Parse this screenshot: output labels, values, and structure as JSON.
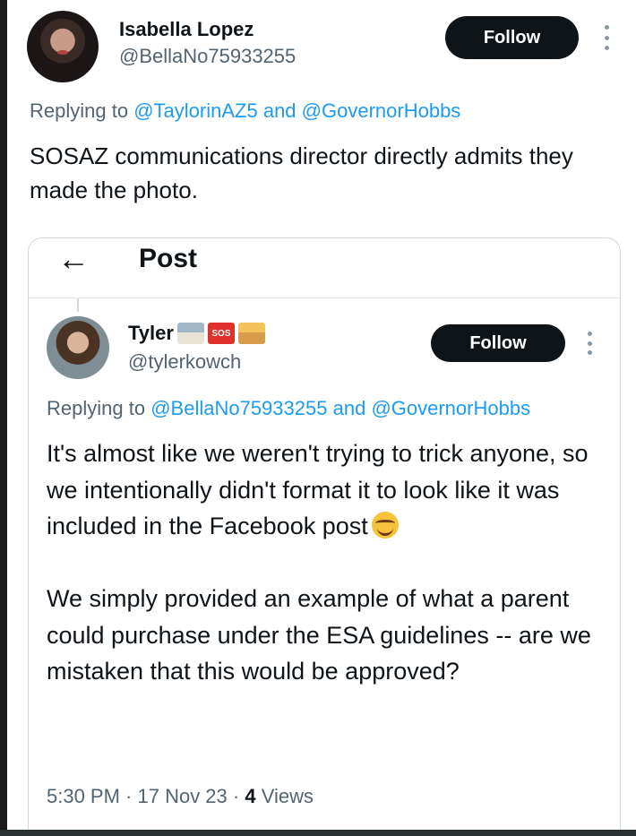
{
  "outer_tweet": {
    "author_name": "Isabella Lopez",
    "author_handle": "@BellaNo75933255",
    "follow_label": "Follow",
    "reply_prefix": "Replying to",
    "reply_mention_1": "@TaylorinAZ5",
    "reply_and": "and",
    "reply_mention_2": "@GovernorHobbs",
    "text": "SOSAZ communications director directly admits they made the photo."
  },
  "embedded_post": {
    "header_title": "Post",
    "back_icon": "arrow-left-icon",
    "author_name": "Tyler",
    "author_emojis": [
      "school-emoji",
      "sos-emoji",
      "desert-emoji"
    ],
    "sos_text": "SOS",
    "author_handle": "@tylerkowch",
    "follow_label": "Follow",
    "reply_prefix": "Replying to",
    "reply_mention_1": "@BellaNo75933255",
    "reply_and": "and",
    "reply_mention_2": "@GovernorHobbs",
    "text_paragraph_1": "It's almost like we weren't trying to trick anyone, so we intentionally didn't format it to look like it was included in the Facebook post",
    "text_paragraph_2": "We simply provided an example of what a parent could purchase under the ESA guidelines -- are we mistaken that this would be approved?",
    "timestamp": "5:30 PM · 17 Nov 23 · ",
    "views_count": "4",
    "views_label": "Views"
  },
  "colors": {
    "link": "#1d9bf0",
    "secondary_text": "#536471",
    "follow_button": "#0f1419"
  }
}
